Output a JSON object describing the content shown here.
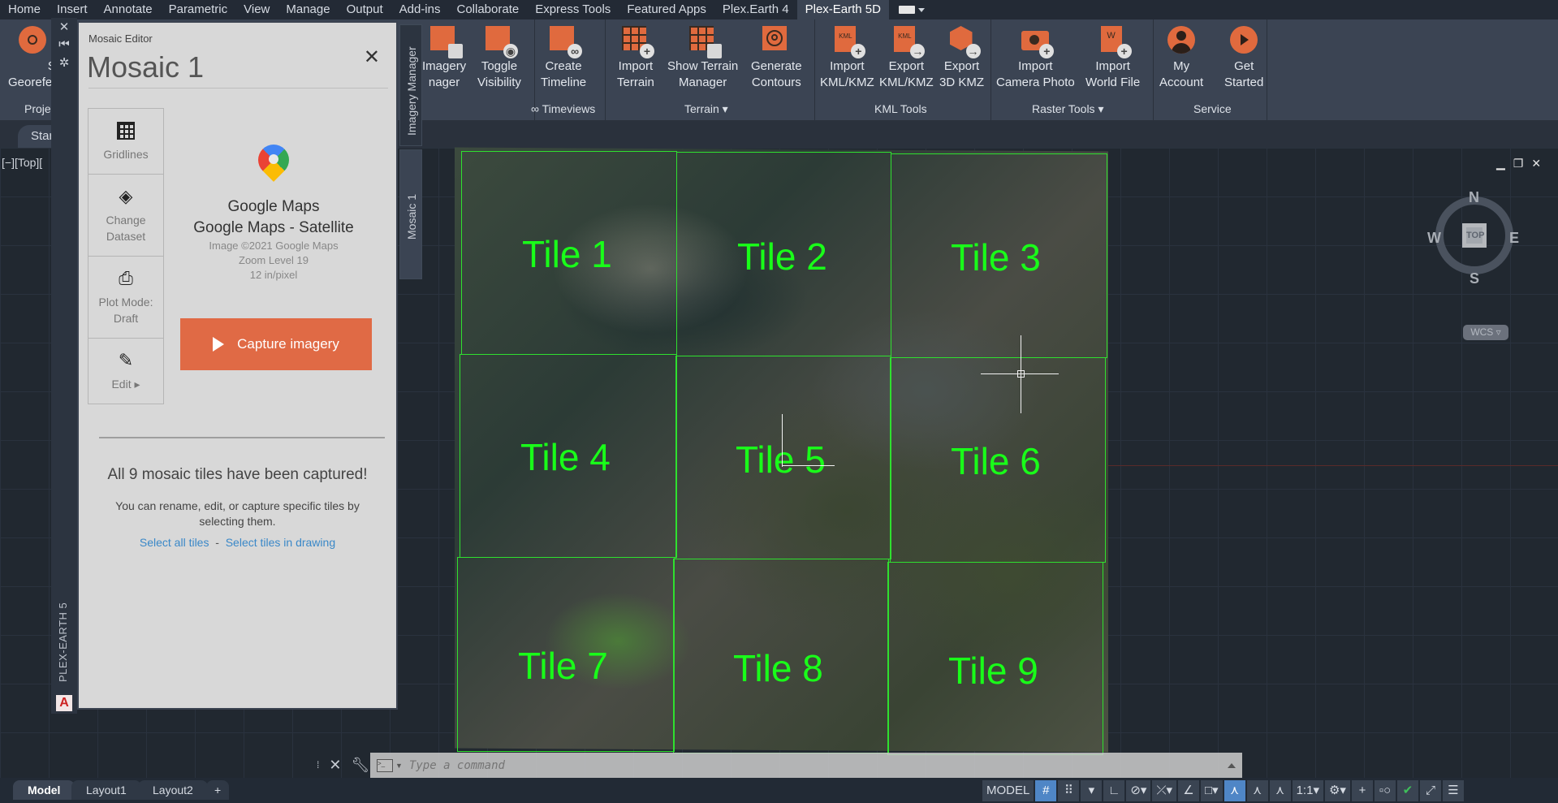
{
  "menu": {
    "tabs": [
      "Home",
      "Insert",
      "Annotate",
      "Parametric",
      "View",
      "Manage",
      "Output",
      "Add-ins",
      "Collaborate",
      "Express Tools",
      "Featured Apps",
      "Plex.Earth 4",
      "Plex-Earth 5D"
    ],
    "active": "Plex-Earth 5D"
  },
  "ribbon": {
    "buttons": [
      {
        "id": "set-georef",
        "label1": "Set",
        "label2": "Georefer",
        "icon": "georeference-icon"
      },
      {
        "id": "imagery-manager",
        "label1": "Imagery",
        "label2": "nager",
        "icon": "imagery-manager-icon"
      },
      {
        "id": "toggle-visibility",
        "label1": "Toggle",
        "label2": "Visibility",
        "icon": "toggle-visibility-icon"
      },
      {
        "id": "create-timeline",
        "label1": "Create",
        "label2": "Timeline",
        "icon": "timeline-icon"
      },
      {
        "id": "import-terrain",
        "label1": "Import",
        "label2": "Terrain",
        "icon": "import-terrain-icon",
        "dropdown": true
      },
      {
        "id": "show-terrain-manager",
        "label1": "Show Terrain",
        "label2": "Manager",
        "icon": "terrain-manager-icon"
      },
      {
        "id": "generate-contours",
        "label1": "Generate",
        "label2": "Contours",
        "icon": "contours-icon",
        "dropdown": true
      },
      {
        "id": "import-kml",
        "label1": "Import",
        "label2": "KML/KMZ",
        "icon": "import-kml-icon"
      },
      {
        "id": "export-kml",
        "label1": "Export",
        "label2": "KML/KMZ",
        "icon": "export-kml-icon"
      },
      {
        "id": "export-3d-kmz",
        "label1": "Export",
        "label2": "3D KMZ",
        "icon": "export-3d-kmz-icon"
      },
      {
        "id": "import-camera-photo",
        "label1": "Import",
        "label2": "Camera Photo",
        "icon": "camera-photo-icon"
      },
      {
        "id": "import-world-file",
        "label1": "Import",
        "label2": "World File",
        "icon": "world-file-icon",
        "dropdown": true
      },
      {
        "id": "my-account",
        "label1": "My",
        "label2": "Account",
        "icon": "account-icon",
        "dropdown": true
      },
      {
        "id": "get-started",
        "label1": "Get",
        "label2": "Started",
        "icon": "get-started-icon"
      }
    ],
    "groups": [
      "Proje",
      "∞ Timeviews",
      "Terrain ▾",
      "KML Tools",
      "Raster Tools ▾",
      "Service"
    ]
  },
  "filetab": {
    "label": "Star"
  },
  "viewport": {
    "label": "[−][Top][",
    "controls": [
      "minimize",
      "restore",
      "close"
    ]
  },
  "palette": {
    "vertical_title": "PLEX-EARTH 5",
    "side_tabs": [
      "Imagery Manager",
      "Mosaic 1"
    ]
  },
  "mosaic_editor": {
    "subtitle": "Mosaic Editor",
    "title": "Mosaic 1",
    "side_buttons": [
      {
        "label": "Gridlines",
        "icon": "grid-icon"
      },
      {
        "label": "Change Dataset",
        "icon": "layers-icon"
      },
      {
        "label": "Plot Mode: Draft",
        "icon": "printer-icon"
      },
      {
        "label": "Edit ▸",
        "icon": "pencil-icon"
      }
    ],
    "dataset": {
      "provider": "Google Maps",
      "name": "Google Maps - Satellite",
      "copyright": "Image ©2021 Google Maps",
      "zoom": "Zoom Level 19",
      "resolution": "12 in/pixel"
    },
    "capture_label": "Capture imagery",
    "done_message": "All 9 mosaic tiles have been captured!",
    "hint": "You can rename, edit, or capture specific tiles by selecting them.",
    "link_all": "Select all tiles",
    "link_sep": "-",
    "link_drawing": "Select tiles in drawing"
  },
  "tiles": [
    "Tile 1",
    "Tile 2",
    "Tile 3",
    "Tile 4",
    "Tile 5",
    "Tile 6",
    "Tile 7",
    "Tile 8",
    "Tile 9"
  ],
  "viewcube": {
    "n": "N",
    "s": "S",
    "e": "E",
    "w": "W",
    "face": "TOP",
    "ucs": "WCS"
  },
  "command": {
    "placeholder": "Type a command"
  },
  "layout_tabs": [
    "Model",
    "Layout1",
    "Layout2"
  ],
  "layout_active": "Model",
  "status": {
    "model": "MODEL",
    "scale": "1:1"
  },
  "colors": {
    "accent": "#e06a3e",
    "tile_line": "#2fe02f",
    "tile_text": "#19ff19",
    "link": "#3a88c8"
  }
}
